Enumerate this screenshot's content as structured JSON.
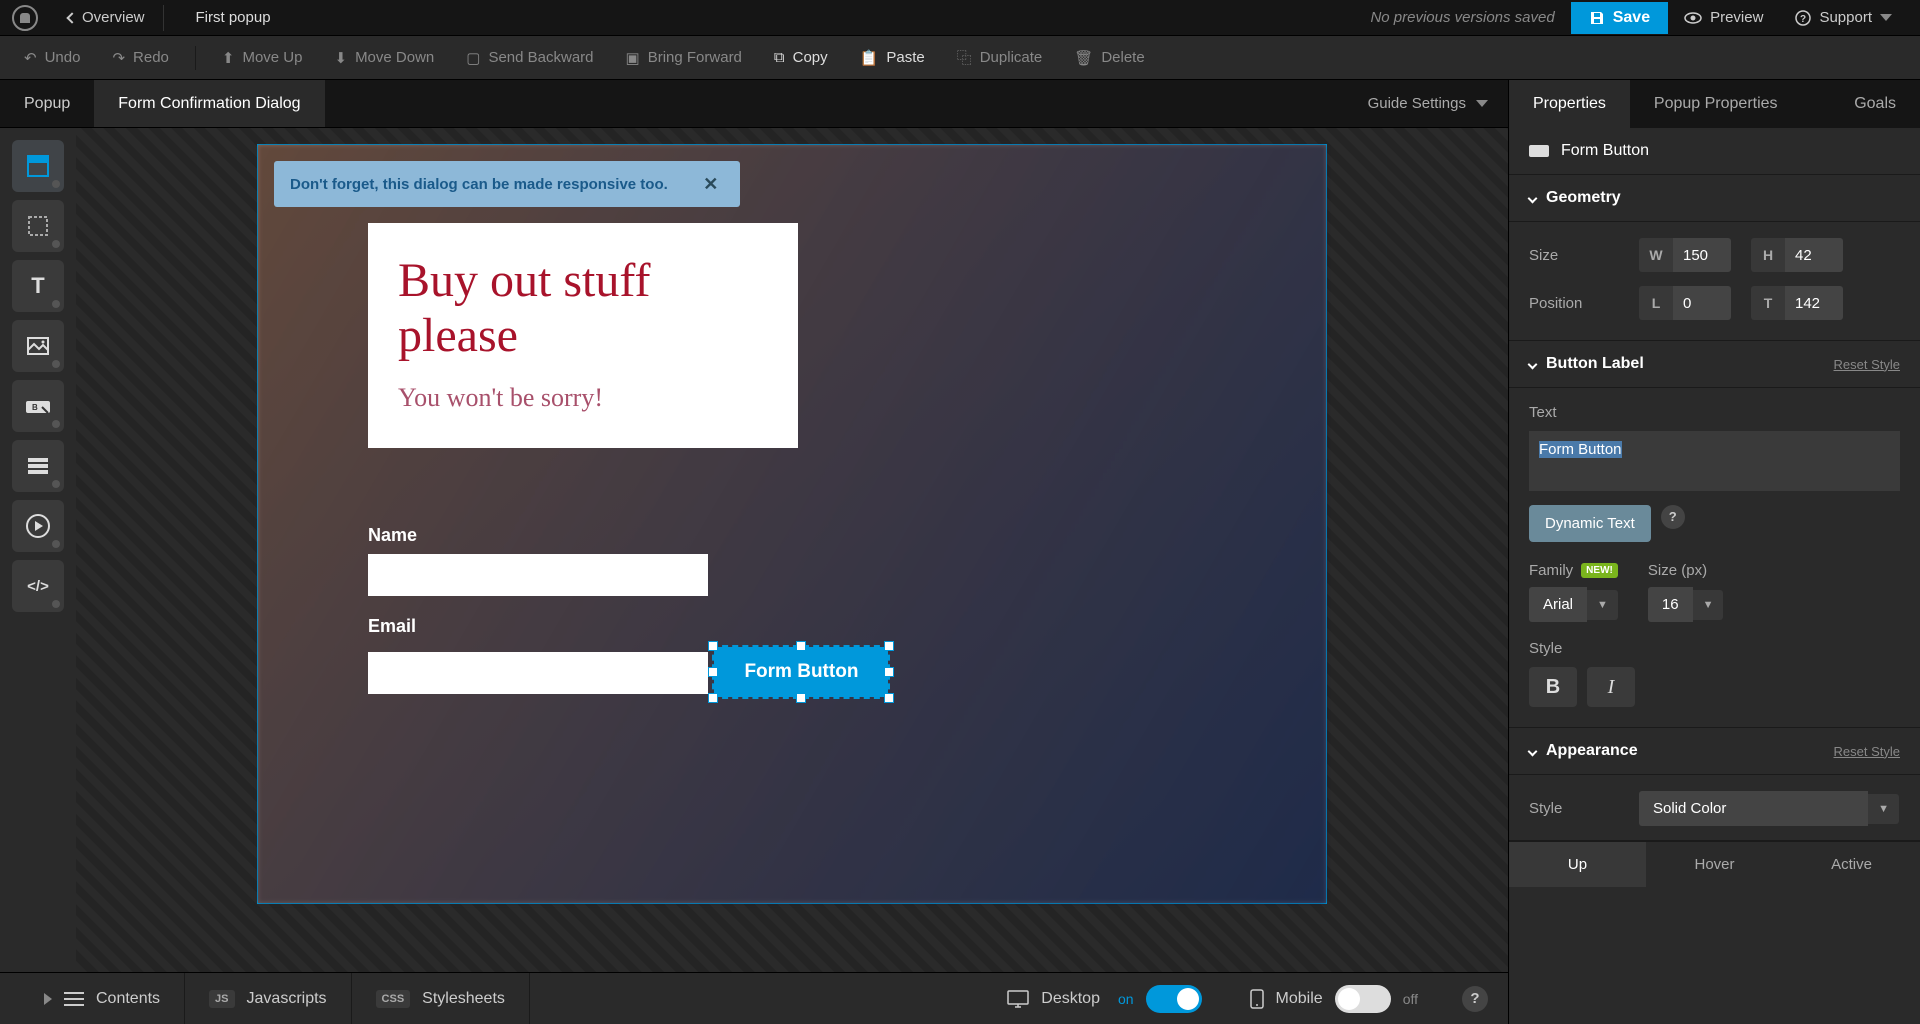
{
  "topbar": {
    "overview": "Overview",
    "title": "First popup",
    "version_status": "No previous versions saved",
    "save": "Save",
    "preview": "Preview",
    "support": "Support"
  },
  "toolbar": {
    "undo": "Undo",
    "redo": "Redo",
    "move_up": "Move Up",
    "move_down": "Move Down",
    "send_backward": "Send Backward",
    "bring_forward": "Bring Forward",
    "copy": "Copy",
    "paste": "Paste",
    "duplicate": "Duplicate",
    "delete": "Delete"
  },
  "main_tabs": {
    "popup": "Popup",
    "form_confirmation": "Form Confirmation Dialog",
    "guide_settings": "Guide Settings"
  },
  "tip": {
    "text": "Don't forget, this dialog can be made responsive too."
  },
  "canvas": {
    "card_title": "Buy out stuff please",
    "card_sub": "You won't be sorry!",
    "name_label": "Name",
    "email_label": "Email",
    "button_label": "Form Button"
  },
  "bottom": {
    "contents": "Contents",
    "javascripts": "Javascripts",
    "stylesheets": "Stylesheets",
    "desktop": "Desktop",
    "on": "on",
    "mobile": "Mobile",
    "off": "off",
    "js_badge": "JS",
    "css_badge": "CSS"
  },
  "panel": {
    "tabs": {
      "properties": "Properties",
      "popup_properties": "Popup Properties",
      "goals": "Goals"
    },
    "element_type": "Form Button",
    "geometry": {
      "title": "Geometry",
      "size": "Size",
      "w": "W",
      "w_val": "150",
      "h": "H",
      "h_val": "42",
      "position": "Position",
      "l": "L",
      "l_val": "0",
      "t": "T",
      "t_val": "142"
    },
    "button_label": {
      "title": "Button Label",
      "reset": "Reset Style",
      "text_label": "Text",
      "text_value": "Form Button",
      "dynamic_text": "Dynamic Text",
      "family": "Family",
      "new_badge": "NEW!",
      "size_label": "Size (px)",
      "family_val": "Arial",
      "size_val": "16",
      "style": "Style"
    },
    "appearance": {
      "title": "Appearance",
      "reset": "Reset Style",
      "style": "Style",
      "style_val": "Solid Color",
      "states": {
        "up": "Up",
        "hover": "Hover",
        "active": "Active"
      }
    }
  }
}
